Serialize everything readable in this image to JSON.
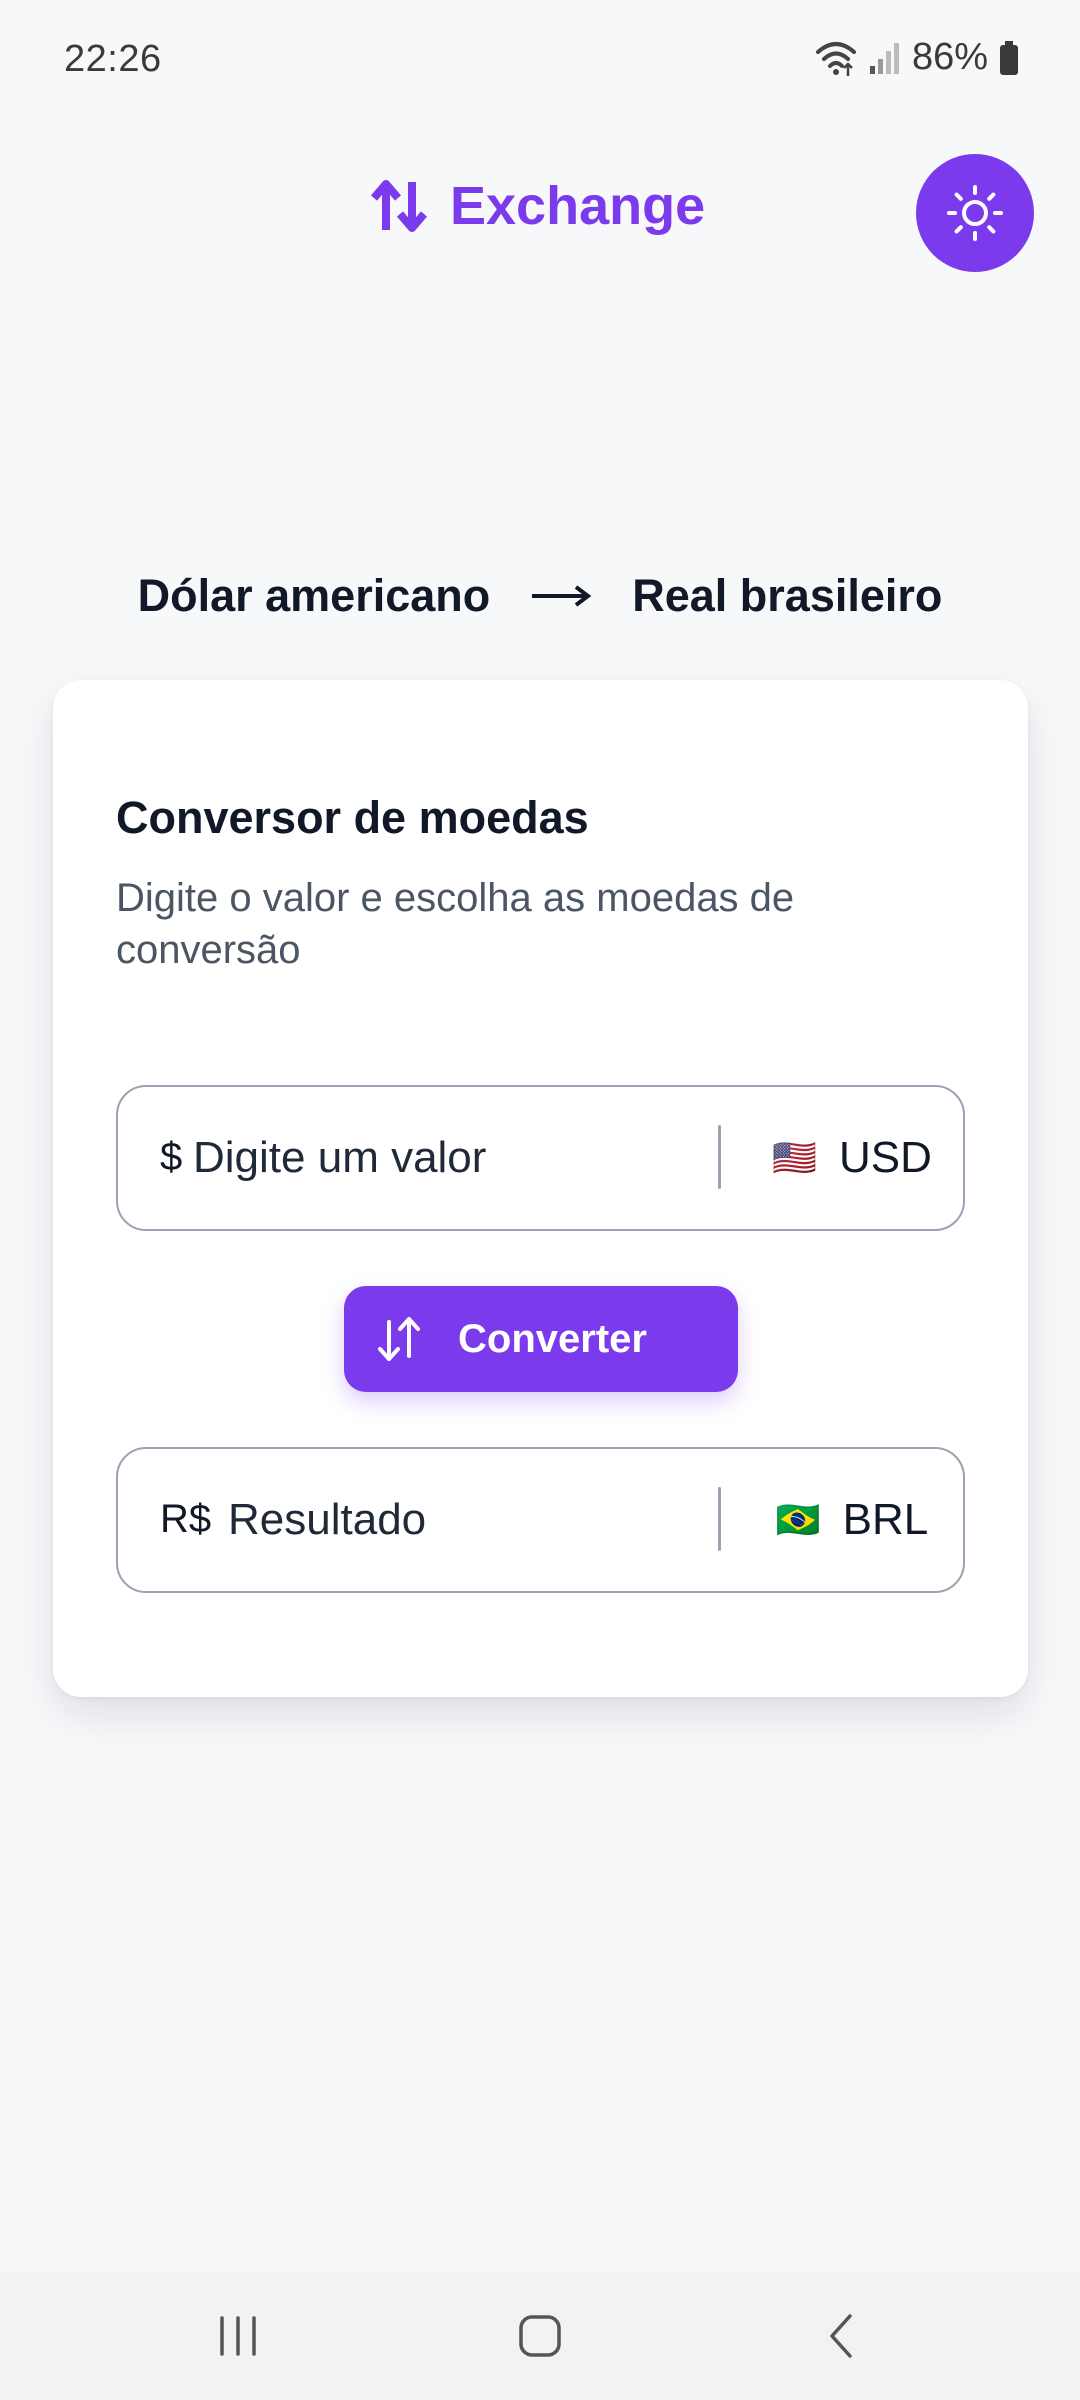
{
  "status_bar": {
    "time": "22:26",
    "battery": "86%"
  },
  "header": {
    "title": "Exchange",
    "icon": "swap-vertical-icon",
    "theme_toggle_icon": "sun-icon"
  },
  "pair": {
    "from": "Dólar americano",
    "arrow": "⟶",
    "to": "Real brasileiro"
  },
  "card": {
    "title": "Conversor de moedas",
    "subtitle": "Digite o valor e escolha as moedas de conversão",
    "amount": {
      "prefix": "$",
      "placeholder": "Digite um valor",
      "flag": "🇺🇸",
      "currency": "USD"
    },
    "convert_button": {
      "label": "Converter",
      "icon": "swap-vertical-icon"
    },
    "result": {
      "prefix": "R$",
      "placeholder": "Resultado",
      "flag": "🇧🇷",
      "currency": "BRL"
    }
  },
  "colors": {
    "accent": "#7c3aed",
    "background": "#f7f8fa",
    "card": "#ffffff",
    "text": "#111827",
    "muted": "#4b5563"
  }
}
